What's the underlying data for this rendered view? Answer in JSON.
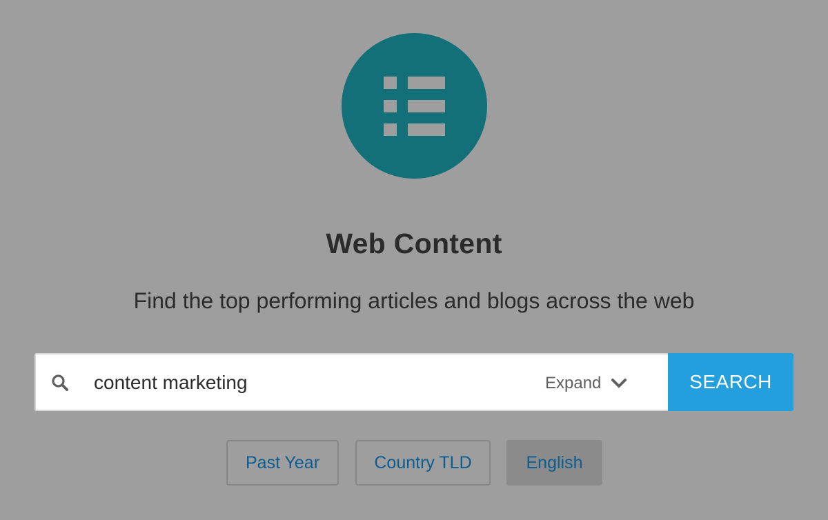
{
  "hero": {
    "icon": "list-icon",
    "circle_color": "#136f78",
    "title": "Web Content",
    "subtitle": "Find the top performing articles and blogs across the web"
  },
  "search": {
    "icon": "search-icon",
    "value": "content marketing",
    "expand_label": "Expand",
    "expand_icon": "chevron-down-icon",
    "button_label": "SEARCH",
    "button_color": "#229fdc"
  },
  "filters": [
    {
      "label": "Past Year",
      "active": false
    },
    {
      "label": "Country TLD",
      "active": false
    },
    {
      "label": "English",
      "active": true
    }
  ]
}
